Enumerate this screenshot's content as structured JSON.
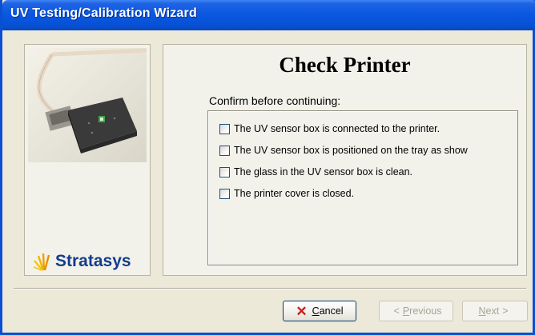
{
  "window": {
    "title": "UV Testing/Calibration Wizard"
  },
  "side_panel": {
    "logo_text": "Stratasys"
  },
  "content": {
    "heading": "Check Printer",
    "confirm_label": "Confirm before continuing:",
    "checklist": [
      {
        "label": "The UV sensor box is connected to the printer.",
        "checked": false
      },
      {
        "label": "The UV sensor box is positioned on the tray as show",
        "checked": false
      },
      {
        "label": "The glass in the UV sensor box is clean.",
        "checked": false
      },
      {
        "label": "The printer cover is closed.",
        "checked": false
      }
    ]
  },
  "buttons": {
    "cancel": "Cancel",
    "previous": "Previous",
    "next": "Next"
  },
  "colors": {
    "title_bar": "#0a58e2",
    "window_bg": "#ece9d8",
    "logo_blue": "#123c8c",
    "cancel_icon": "#cc1a1a"
  },
  "icons": {
    "cancel": "x-icon",
    "previous": "chevron-left-icon",
    "next": "chevron-right-icon"
  }
}
